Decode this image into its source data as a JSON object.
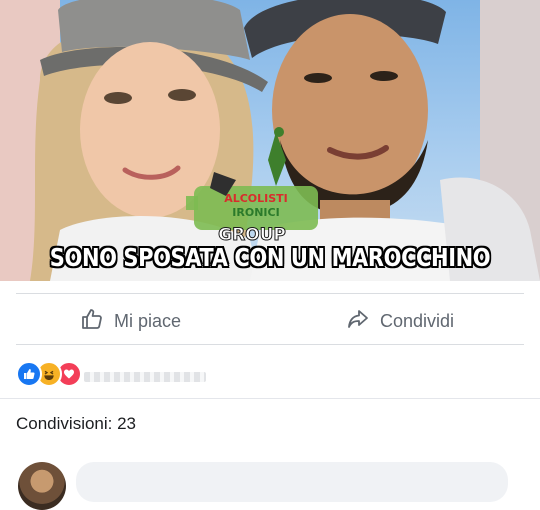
{
  "post": {
    "image_caption": "SONO SPOSATA CON UN MAROCCHINO",
    "watermark": {
      "line1": "ALCOLISTI",
      "line2": "IRONICI",
      "line3": "GROUP"
    }
  },
  "actions": {
    "like_label": "Mi piace",
    "share_label": "Condividi"
  },
  "reactions": {
    "icons": [
      "thumbs-up-icon",
      "haha-emoji-icon",
      "heart-icon"
    ]
  },
  "shares": {
    "label": "Condivisioni: 23"
  },
  "colors": {
    "like_blue": "#1877f2",
    "haha_yellow": "#f7b125",
    "love_red": "#f33e58",
    "action_gray": "#606770",
    "text_dark": "#1c1e21",
    "divider": "#dadde1"
  }
}
